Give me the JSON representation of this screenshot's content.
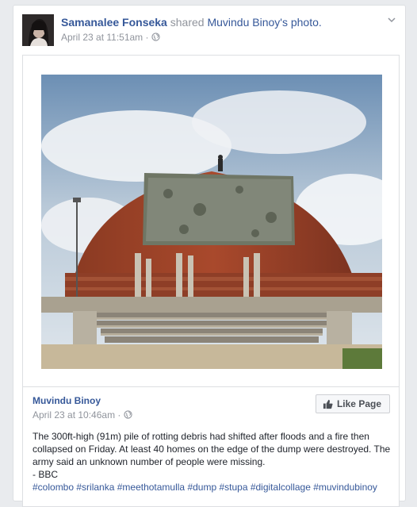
{
  "post": {
    "author": "Samanalee Fonseka",
    "shared_word": "shared",
    "shared_from": "Muvindu Binoy's photo.",
    "timestamp": "April 23 at 11:51am",
    "separator": "·",
    "audience_icon": "globe-icon",
    "menu_icon": "chevron-down-icon"
  },
  "shared_post": {
    "page_name": "Muvindu Binoy",
    "timestamp": "April 23 at 10:46am",
    "separator": "·",
    "audience_icon": "globe-icon",
    "like_page_label": "Like Page",
    "body_lines": [
      "The 300ft-high (91m) pile of rotting debris had shifted after floods and a fire then",
      "collapsed on Friday. At least 40 homes on the edge of the dump were destroyed. The",
      "army said an unknown number of people were missing.",
      "- BBC"
    ],
    "hashtags": "#colombo #srilanka #meethotamulla #dump #stupa #digitalcollage #muvindubinoy"
  },
  "colors": {
    "link": "#365899",
    "muted": "#90949c",
    "background": "#e9ebee"
  }
}
